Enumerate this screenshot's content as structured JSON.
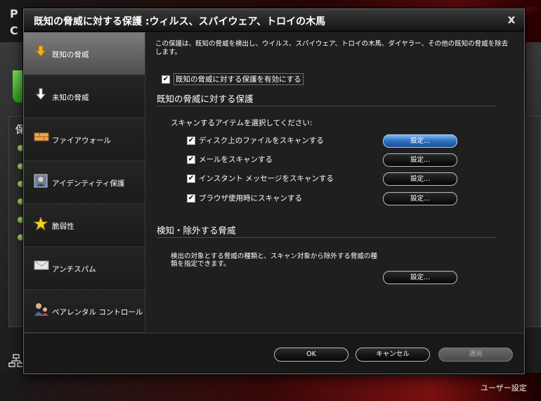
{
  "background": {
    "footer_link": "ユーザー設定",
    "letters": [
      "P",
      "C",
      "保"
    ]
  },
  "dialog": {
    "title": "既知の脅威に対する保護 :ウィルス、スパイウェア、トロイの木馬",
    "close_label": "x"
  },
  "sidebar": {
    "items": [
      {
        "label": "既知の脅威",
        "icon": "download-arrow-icon"
      },
      {
        "label": "未知の脅威",
        "icon": "down-arrow-icon"
      },
      {
        "label": "ファイアウォール",
        "icon": "firewall-brick-icon"
      },
      {
        "label": "アイデンティティ保護",
        "icon": "id-card-icon"
      },
      {
        "label": "脆弱性",
        "icon": "star-icon"
      },
      {
        "label": "アンチスパム",
        "icon": "envelope-icon"
      },
      {
        "label": "ペアレンタル コントロール",
        "icon": "parent-child-icon"
      }
    ]
  },
  "content": {
    "description": "この保護は、既知の脅威を検出し、ウイルス、スパイウェア、トロイの木馬、ダイヤラー、その他の既知の脅威を除去します。",
    "enable_label": "既知の脅威に対する保護を有効にする",
    "section1_title": "既知の脅威に対する保護",
    "select_prompt": "スキャンするアイテムを選択してください:",
    "scan_items": [
      {
        "label": "ディスク上のファイルをスキャンする",
        "button": "設定..."
      },
      {
        "label": "メールをスキャンする",
        "button": "設定..."
      },
      {
        "label": "インスタント メッセージをスキャンする",
        "button": "設定..."
      },
      {
        "label": "ブラウザ使用時にスキャンする",
        "button": "設定..."
      }
    ],
    "section2_title": "検知・除外する脅威",
    "exclude_desc": "検出の対象とする脅威の種類と、スキャン対象から除外する脅威の種類を指定できます。",
    "exclude_button": "設定..."
  },
  "footer": {
    "ok": "OK",
    "cancel": "キャンセル",
    "apply": "適用"
  }
}
